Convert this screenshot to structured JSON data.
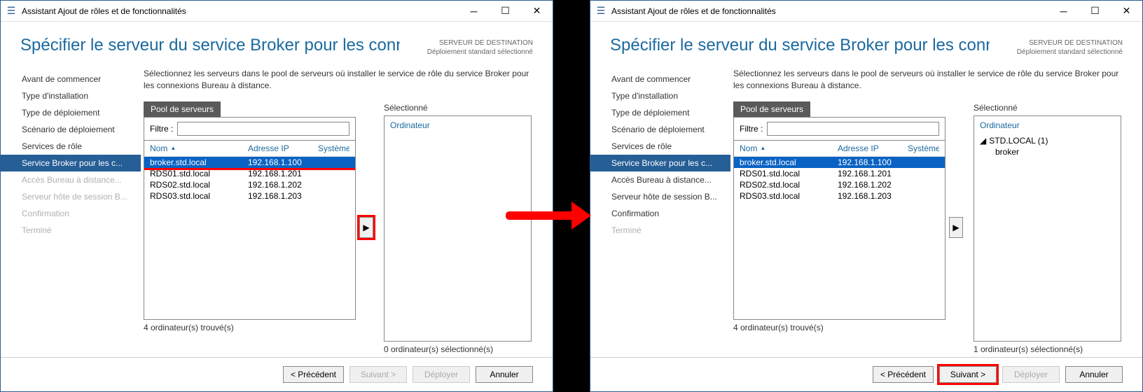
{
  "titlebar": {
    "title": "Assistant Ajout de rôles et de fonctionnalités"
  },
  "heading": "Spécifier le serveur du service Broker pour les connexi...",
  "dest_label": "SERVEUR DE DESTINATION",
  "dest_value": "Déploiement standard sélectionné",
  "instructions": "Sélectionnez les serveurs dans le pool de serveurs où installer le service de rôle du service Broker pour les connexions Bureau à distance.",
  "steps": {
    "s0": "Avant de commencer",
    "s1": "Type d'installation",
    "s2": "Type de déploiement",
    "s3": "Scénario de déploiement",
    "s4": "Services de rôle",
    "s5": "Service Broker pour les c...",
    "s6": "Accès Bureau à distance...",
    "s7": "Serveur hôte de session B...",
    "s8": "Confirmation",
    "s9": "Terminé"
  },
  "pool": {
    "tab": "Pool de serveurs",
    "filter_label": "Filtre :",
    "col_name": "Nom",
    "col_ip": "Adresse IP",
    "col_os": "Système d",
    "rows": [
      {
        "name": "broker.std.local",
        "ip": "192.168.1.100"
      },
      {
        "name": "RDS01.std.local",
        "ip": "192.168.1.201"
      },
      {
        "name": "RDS02.std.local",
        "ip": "192.168.1.202"
      },
      {
        "name": "RDS03.std.local",
        "ip": "192.168.1.203"
      }
    ],
    "count": "4 ordinateur(s) trouvé(s)"
  },
  "selected": {
    "label": "Sélectionné",
    "header": "Ordinateur",
    "count_none": "0 ordinateur(s) sélectionné(s)",
    "count_one": "1 ordinateur(s) sélectionné(s)",
    "group": "STD.LOCAL (1)",
    "item": "broker"
  },
  "footer": {
    "prev": "< Précédent",
    "next": "Suivant >",
    "deploy": "Déployer",
    "cancel": "Annuler"
  }
}
